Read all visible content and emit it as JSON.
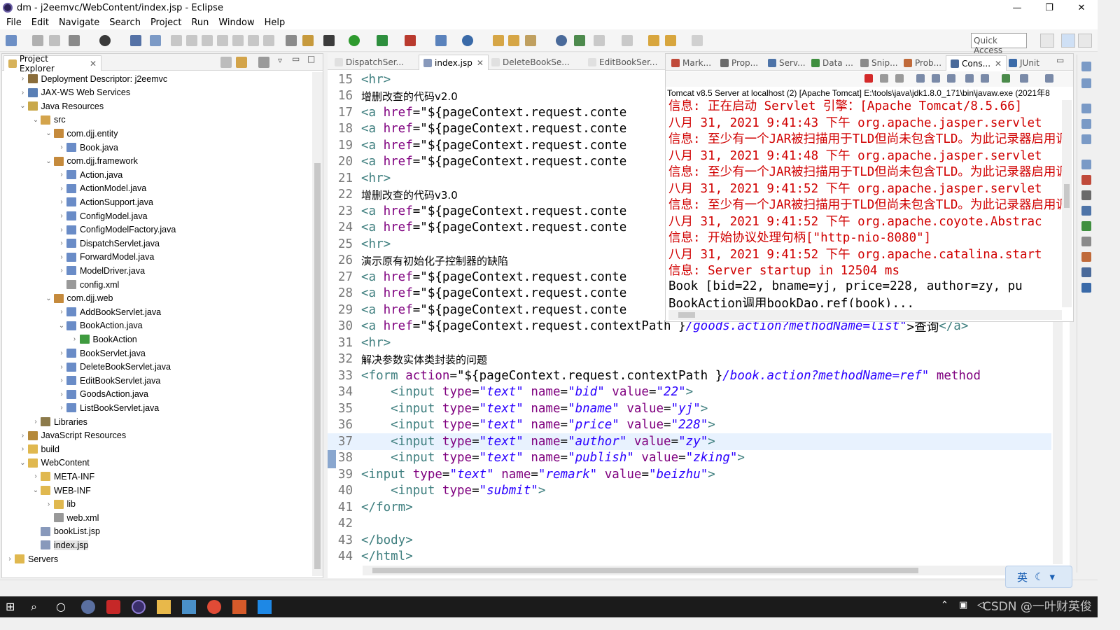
{
  "window": {
    "title": "dm - j2eemvc/WebContent/index.jsp - Eclipse",
    "controls": [
      "—",
      "❐",
      "✕"
    ]
  },
  "menu": [
    "File",
    "Edit",
    "Navigate",
    "Search",
    "Project",
    "Run",
    "Window",
    "Help"
  ],
  "toolbar": {
    "quick_access": "Quick Access"
  },
  "project_explorer": {
    "tab": "Project Explorer",
    "tree": [
      {
        "label": "Deployment Descriptor: j2eemvc",
        "depth": 1,
        "arrow": "›",
        "icon": "descriptor-icon",
        "color": "#8a6d3b"
      },
      {
        "label": "JAX-WS Web Services",
        "depth": 1,
        "arrow": "›",
        "icon": "webservice-icon",
        "color": "#5a7fb5"
      },
      {
        "label": "Java Resources",
        "depth": 1,
        "arrow": "⌄",
        "icon": "java-resources-icon",
        "color": "#c9a84a"
      },
      {
        "label": "src",
        "depth": 2,
        "arrow": "⌄",
        "icon": "source-folder-icon",
        "color": "#d4a44c"
      },
      {
        "label": "com.djj.entity",
        "depth": 3,
        "arrow": "⌄",
        "icon": "package-icon",
        "color": "#c58a3c"
      },
      {
        "label": "Book.java",
        "depth": 4,
        "arrow": "›",
        "icon": "java-file-icon",
        "color": "#6a8cc7"
      },
      {
        "label": "com.djj.framework",
        "depth": 3,
        "arrow": "⌄",
        "icon": "package-icon",
        "color": "#c58a3c"
      },
      {
        "label": "Action.java",
        "depth": 4,
        "arrow": "›",
        "icon": "java-file-icon",
        "color": "#6a8cc7"
      },
      {
        "label": "ActionModel.java",
        "depth": 4,
        "arrow": "›",
        "icon": "java-file-icon",
        "color": "#6a8cc7"
      },
      {
        "label": "ActionSupport.java",
        "depth": 4,
        "arrow": "›",
        "icon": "java-file-icon",
        "color": "#6a8cc7"
      },
      {
        "label": "ConfigModel.java",
        "depth": 4,
        "arrow": "›",
        "icon": "java-file-icon",
        "color": "#6a8cc7"
      },
      {
        "label": "ConfigModelFactory.java",
        "depth": 4,
        "arrow": "›",
        "icon": "java-file-icon",
        "color": "#6a8cc7"
      },
      {
        "label": "DispatchServlet.java",
        "depth": 4,
        "arrow": "›",
        "icon": "java-file-icon",
        "color": "#6a8cc7"
      },
      {
        "label": "ForwardModel.java",
        "depth": 4,
        "arrow": "›",
        "icon": "java-file-icon",
        "color": "#6a8cc7"
      },
      {
        "label": "ModelDriver.java",
        "depth": 4,
        "arrow": "›",
        "icon": "java-file-icon",
        "color": "#6a8cc7"
      },
      {
        "label": "config.xml",
        "depth": 4,
        "arrow": "",
        "icon": "xml-file-icon",
        "color": "#999999"
      },
      {
        "label": "com.djj.web",
        "depth": 3,
        "arrow": "⌄",
        "icon": "package-icon",
        "color": "#c58a3c"
      },
      {
        "label": "AddBookServlet.java",
        "depth": 4,
        "arrow": "›",
        "icon": "java-file-icon",
        "color": "#6a8cc7"
      },
      {
        "label": "BookAction.java",
        "depth": 4,
        "arrow": "⌄",
        "icon": "java-file-icon",
        "color": "#6a8cc7"
      },
      {
        "label": "BookAction",
        "depth": 5,
        "arrow": "›",
        "icon": "class-icon",
        "color": "#3f9b3f"
      },
      {
        "label": "BookServlet.java",
        "depth": 4,
        "arrow": "›",
        "icon": "java-file-icon",
        "color": "#6a8cc7"
      },
      {
        "label": "DeleteBookServlet.java",
        "depth": 4,
        "arrow": "›",
        "icon": "java-file-icon",
        "color": "#6a8cc7"
      },
      {
        "label": "EditBookServlet.java",
        "depth": 4,
        "arrow": "›",
        "icon": "java-file-icon",
        "color": "#6a8cc7"
      },
      {
        "label": "GoodsAction.java",
        "depth": 4,
        "arrow": "›",
        "icon": "java-file-icon",
        "color": "#6a8cc7"
      },
      {
        "label": "ListBookServlet.java",
        "depth": 4,
        "arrow": "›",
        "icon": "java-file-icon",
        "color": "#6a8cc7"
      },
      {
        "label": "Libraries",
        "depth": 2,
        "arrow": "›",
        "icon": "libraries-icon",
        "color": "#8c7a4a"
      },
      {
        "label": "JavaScript Resources",
        "depth": 1,
        "arrow": "›",
        "icon": "js-resources-icon",
        "color": "#b5893a"
      },
      {
        "label": "build",
        "depth": 1,
        "arrow": "›",
        "icon": "folder-icon",
        "color": "#e0b84f"
      },
      {
        "label": "WebContent",
        "depth": 1,
        "arrow": "⌄",
        "icon": "folder-icon",
        "color": "#e0b84f"
      },
      {
        "label": "META-INF",
        "depth": 2,
        "arrow": "›",
        "icon": "folder-icon",
        "color": "#e0b84f"
      },
      {
        "label": "WEB-INF",
        "depth": 2,
        "arrow": "⌄",
        "icon": "folder-icon",
        "color": "#e0b84f"
      },
      {
        "label": "lib",
        "depth": 3,
        "arrow": "›",
        "icon": "folder-icon",
        "color": "#e0b84f"
      },
      {
        "label": "web.xml",
        "depth": 3,
        "arrow": "",
        "icon": "xml-file-icon",
        "color": "#999999"
      },
      {
        "label": "bookList.jsp",
        "depth": 2,
        "arrow": "",
        "icon": "jsp-file-icon",
        "color": "#8899bb"
      },
      {
        "label": "index.jsp",
        "depth": 2,
        "arrow": "",
        "icon": "jsp-file-icon",
        "color": "#8899bb",
        "selected": true
      },
      {
        "label": "Servers",
        "depth": 0,
        "arrow": "›",
        "icon": "folder-icon",
        "color": "#e0b84f"
      }
    ]
  },
  "editor": {
    "tabs": [
      {
        "label": "DispatchSer...",
        "active": false
      },
      {
        "label": "index.jsp",
        "active": true
      },
      {
        "label": "DeleteBookSe...",
        "active": false
      },
      {
        "label": "EditBookSer...",
        "active": false
      }
    ],
    "lines": [
      {
        "n": "15",
        "segs": [
          [
            "tag",
            "<hr>"
          ]
        ]
      },
      {
        "n": "16",
        "segs": [
          [
            "cjk",
            "增删改查的代码v2.0"
          ]
        ]
      },
      {
        "n": "17",
        "segs": [
          [
            "tag",
            "<a "
          ],
          [
            "attr",
            "href"
          ],
          [
            "cl",
            "=\"${pageContext.request.conte"
          ]
        ]
      },
      {
        "n": "18",
        "segs": [
          [
            "tag",
            "<a "
          ],
          [
            "attr",
            "href"
          ],
          [
            "cl",
            "=\"${pageContext.request.conte"
          ]
        ]
      },
      {
        "n": "19",
        "segs": [
          [
            "tag",
            "<a "
          ],
          [
            "attr",
            "href"
          ],
          [
            "cl",
            "=\"${pageContext.request.conte"
          ]
        ]
      },
      {
        "n": "20",
        "segs": [
          [
            "tag",
            "<a "
          ],
          [
            "attr",
            "href"
          ],
          [
            "cl",
            "=\"${pageContext.request.conte"
          ]
        ]
      },
      {
        "n": "21",
        "segs": [
          [
            "tag",
            "<hr>"
          ]
        ]
      },
      {
        "n": "22",
        "segs": [
          [
            "cjk",
            "增删改查的代码v3.0"
          ]
        ]
      },
      {
        "n": "23",
        "segs": [
          [
            "tag",
            "<a "
          ],
          [
            "attr",
            "href"
          ],
          [
            "cl",
            "=\"${pageContext.request.conte"
          ]
        ]
      },
      {
        "n": "24",
        "segs": [
          [
            "tag",
            "<a "
          ],
          [
            "attr",
            "href"
          ],
          [
            "cl",
            "=\"${pageContext.request.conte"
          ]
        ]
      },
      {
        "n": "25",
        "segs": [
          [
            "tag",
            "<hr>"
          ]
        ]
      },
      {
        "n": "26",
        "segs": [
          [
            "cjk",
            "演示原有初始化子控制器的缺陷"
          ]
        ]
      },
      {
        "n": "27",
        "segs": [
          [
            "tag",
            "<a "
          ],
          [
            "attr",
            "href"
          ],
          [
            "cl",
            "=\"${pageContext.request.conte"
          ]
        ]
      },
      {
        "n": "28",
        "segs": [
          [
            "tag",
            "<a "
          ],
          [
            "attr",
            "href"
          ],
          [
            "cl",
            "=\"${pageContext.request.conte"
          ]
        ]
      },
      {
        "n": "29",
        "segs": [
          [
            "tag",
            "<a "
          ],
          [
            "attr",
            "href"
          ],
          [
            "cl",
            "=\"${pageContext.request.conte"
          ]
        ]
      },
      {
        "n": "30",
        "segs": [
          [
            "tag",
            "<a "
          ],
          [
            "attr",
            "href"
          ],
          [
            "cl",
            "=\"${pageContext.request.contextPath }"
          ],
          [
            "str",
            "/goods.action?methodName=list\""
          ],
          [
            "cl",
            ">查询"
          ],
          [
            "tag",
            "</a>"
          ]
        ]
      },
      {
        "n": "31",
        "segs": [
          [
            "tag",
            "<hr>"
          ]
        ]
      },
      {
        "n": "32",
        "segs": [
          [
            "cjk",
            "解决参数实体类封装的问题"
          ]
        ]
      },
      {
        "n": "33",
        "segs": [
          [
            "tag",
            "<form "
          ],
          [
            "attr",
            "action"
          ],
          [
            "cl",
            "=\"${pageContext.request.contextPath }"
          ],
          [
            "str",
            "/book.action?methodName=ref\""
          ],
          [
            "attr",
            " method"
          ]
        ]
      },
      {
        "n": "34",
        "segs": [
          [
            "tag",
            "    <input "
          ],
          [
            "attr",
            "type"
          ],
          [
            "cl",
            "="
          ],
          [
            "str",
            "\"text\""
          ],
          [
            "attr",
            " name"
          ],
          [
            "cl",
            "="
          ],
          [
            "str",
            "\"bid\""
          ],
          [
            "attr",
            " value"
          ],
          [
            "cl",
            "="
          ],
          [
            "str",
            "\"22\""
          ],
          [
            "tag",
            ">"
          ]
        ]
      },
      {
        "n": "35",
        "segs": [
          [
            "tag",
            "    <input "
          ],
          [
            "attr",
            "type"
          ],
          [
            "cl",
            "="
          ],
          [
            "str",
            "\"text\""
          ],
          [
            "attr",
            " name"
          ],
          [
            "cl",
            "="
          ],
          [
            "str",
            "\"bname\""
          ],
          [
            "attr",
            " value"
          ],
          [
            "cl",
            "="
          ],
          [
            "str",
            "\"yj\""
          ],
          [
            "tag",
            ">"
          ]
        ]
      },
      {
        "n": "36",
        "segs": [
          [
            "tag",
            "    <input "
          ],
          [
            "attr",
            "type"
          ],
          [
            "cl",
            "="
          ],
          [
            "str",
            "\"text\""
          ],
          [
            "attr",
            " name"
          ],
          [
            "cl",
            "="
          ],
          [
            "str",
            "\"price\""
          ],
          [
            "attr",
            " value"
          ],
          [
            "cl",
            "="
          ],
          [
            "str",
            "\"228\""
          ],
          [
            "tag",
            ">"
          ]
        ]
      },
      {
        "n": "37",
        "segs": [
          [
            "tag",
            "    <input "
          ],
          [
            "attr",
            "type"
          ],
          [
            "cl",
            "="
          ],
          [
            "str",
            "\"text\""
          ],
          [
            "attr",
            " name"
          ],
          [
            "cl",
            "="
          ],
          [
            "str",
            "\"author\""
          ],
          [
            "attr",
            " value"
          ],
          [
            "cl",
            "="
          ],
          [
            "str",
            "\"zy\""
          ],
          [
            "tag",
            ">"
          ]
        ],
        "current": true
      },
      {
        "n": "38",
        "segs": [
          [
            "tag",
            "    <input "
          ],
          [
            "attr",
            "type"
          ],
          [
            "cl",
            "="
          ],
          [
            "str",
            "\"text\""
          ],
          [
            "attr",
            " name"
          ],
          [
            "cl",
            "="
          ],
          [
            "str",
            "\"publish\""
          ],
          [
            "attr",
            " value"
          ],
          [
            "cl",
            "="
          ],
          [
            "str",
            "\"zking\""
          ],
          [
            "tag",
            ">"
          ]
        ]
      },
      {
        "n": "39",
        "segs": [
          [
            "tag",
            "<input "
          ],
          [
            "attr",
            "type"
          ],
          [
            "cl",
            "="
          ],
          [
            "str",
            "\"text\""
          ],
          [
            "attr",
            " name"
          ],
          [
            "cl",
            "="
          ],
          [
            "str",
            "\"remark\""
          ],
          [
            "attr",
            " value"
          ],
          [
            "cl",
            "="
          ],
          [
            "str",
            "\"beizhu\""
          ],
          [
            "tag",
            ">"
          ]
        ]
      },
      {
        "n": "40",
        "segs": [
          [
            "tag",
            "    <input "
          ],
          [
            "attr",
            "type"
          ],
          [
            "cl",
            "="
          ],
          [
            "str",
            "\"submit\""
          ],
          [
            "tag",
            ">"
          ]
        ]
      },
      {
        "n": "41",
        "segs": [
          [
            "tag",
            "</form>"
          ]
        ]
      },
      {
        "n": "42",
        "segs": []
      },
      {
        "n": "43",
        "segs": [
          [
            "tag",
            "</body>"
          ]
        ]
      },
      {
        "n": "44",
        "segs": [
          [
            "tag",
            "</html>"
          ]
        ]
      }
    ]
  },
  "right_panel": {
    "tabs": [
      "Mark...",
      "Prop...",
      "Serv...",
      "Data ...",
      "Snip...",
      "Prob...",
      "Cons...",
      "JUnit"
    ],
    "active_tab": "Cons...",
    "console_header": "Tomcat v8.5 Server at localhost (2) [Apache Tomcat] E:\\tools\\java\\jdk1.8.0_171\\bin\\javaw.exe (2021年8",
    "lines": [
      {
        "text": "信息: 正在启动 Servlet 引擎：[Apache Tomcat/8.5.66]",
        "color": "red"
      },
      {
        "text": "八月 31, 2021 9:41:43 下午 org.apache.jasper.servlet",
        "color": "red"
      },
      {
        "text": "信息: 至少有一个JAR被扫描用于TLD但尚未包含TLD。为此记录器启用调试",
        "color": "red"
      },
      {
        "text": "八月 31, 2021 9:41:48 下午 org.apache.jasper.servlet",
        "color": "red"
      },
      {
        "text": "信息: 至少有一个JAR被扫描用于TLD但尚未包含TLD。为此记录器启用调试",
        "color": "red"
      },
      {
        "text": "八月 31, 2021 9:41:52 下午 org.apache.jasper.servlet",
        "color": "red"
      },
      {
        "text": "信息: 至少有一个JAR被扫描用于TLD但尚未包含TLD。为此记录器启用调试",
        "color": "red"
      },
      {
        "text": "八月 31, 2021 9:41:52 下午 org.apache.coyote.Abstrac",
        "color": "red"
      },
      {
        "text": "信息: 开始协议处理句柄[\"http-nio-8080\"]",
        "color": "red"
      },
      {
        "text": "八月 31, 2021 9:41:52 下午 org.apache.catalina.start",
        "color": "red"
      },
      {
        "text": "信息: Server startup in 12504 ms",
        "color": "red"
      },
      {
        "text": "Book [bid=22, bname=yj, price=228, author=zy, pu",
        "color": "black"
      },
      {
        "text": "BookAction调用bookDao.ref(book)...",
        "color": "black"
      }
    ]
  },
  "ime": {
    "label": "英"
  },
  "watermark": "CSDN @一叶财英俊",
  "colors": {
    "tag": "#3f7f7f",
    "attr": "#7f007f",
    "string": "#2a00ff",
    "console_red": "#d00000",
    "taskbar": "#1b1b1b"
  }
}
